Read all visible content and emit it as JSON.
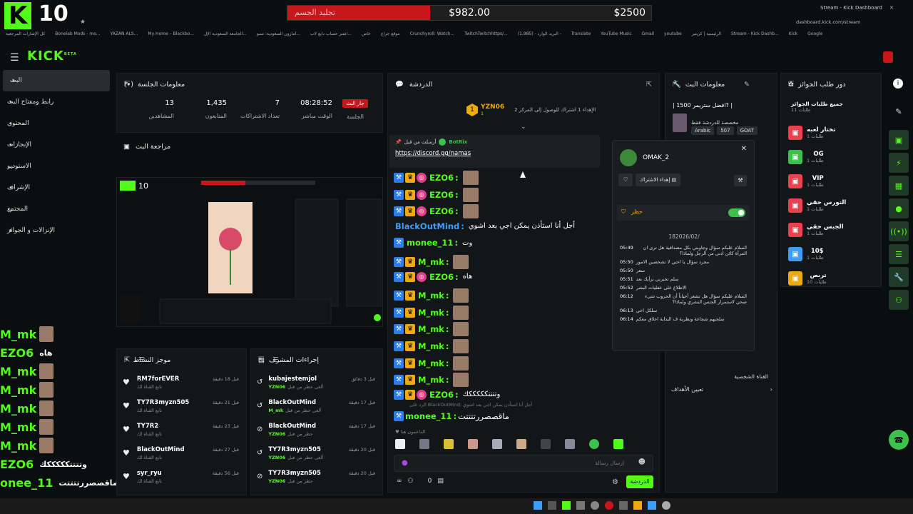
{
  "overlay": {
    "logo_letter": "K",
    "logo_number": "10",
    "goal": {
      "title": "تجليد الجسم",
      "current": "$982.00",
      "target": "$2500",
      "progress": 0.393,
      "color": "#c8161d"
    }
  },
  "browser": {
    "active_tab": "Stream - Kick Dashboard",
    "url": "dashboard.kick.com/stream",
    "bookmarks": [
      "كل الإشارات المرجعية",
      "Bonelab Mods - mo...",
      "YAZAN ALS...",
      "My Home – Blackbo...",
      "الجامعة السعودية الإل...",
      "أمازون السعودية: تسو...",
      "اشتر حساب دايغ لاب...",
      "خاص",
      "موقع جراج",
      "Crunchyroll: Watch...",
      "TwitchTwitchhttps/...",
      "(1,985) - البريد الوارد -",
      "Translate",
      "YouTube Music",
      "Gmail",
      "youtube",
      "الرئيسية | كريتير",
      "Stream - Kick Dashb...",
      "Kick",
      "Google"
    ]
  },
  "app": {
    "brand": "KICK",
    "brand_sup": "BETA"
  },
  "sidebar": {
    "items": [
      {
        "label": "البث",
        "icon": "broadcast-icon"
      },
      {
        "label": "رابط ومفتاح البث",
        "icon": "link-icon"
      },
      {
        "label": "المحتوى",
        "icon": "content-icon"
      },
      {
        "label": "الإنجازات",
        "icon": "trophy-icon"
      },
      {
        "label": "الاستوديو",
        "icon": "chevron-down-icon"
      },
      {
        "label": "الإشراف",
        "icon": "hammer-icon"
      },
      {
        "label": "المجتمع",
        "icon": "chevron-down-icon"
      },
      {
        "label": "الإنزالات و الجوائز",
        "icon": "gift-icon"
      }
    ]
  },
  "session": {
    "title": "معلومات الجلسة",
    "live_badge": "جار البث",
    "live_label": "الجلسة",
    "stats": [
      {
        "value": "08:28:52",
        "label": "الوقت مباشر"
      },
      {
        "value": "7",
        "label": "تعداد الاشتراكات"
      },
      {
        "value": "1,435",
        "label": "المتابعون"
      },
      {
        "value": "13",
        "label": "المشاهدين"
      }
    ]
  },
  "preview": {
    "title": "مراجعة البث"
  },
  "overlay_chat": [
    {
      "user": "M_mk",
      "text": "",
      "color": "#53fc18"
    },
    {
      "user": "EZO6",
      "text": "هاه",
      "color": "#53fc18"
    },
    {
      "user": "M_mk",
      "text": "",
      "color": "#53fc18"
    },
    {
      "user": "M_mk",
      "text": "",
      "color": "#53fc18"
    },
    {
      "user": "M_mk",
      "text": "",
      "color": "#53fc18"
    },
    {
      "user": "M_mk",
      "text": "",
      "color": "#53fc18"
    },
    {
      "user": "M_mk",
      "text": "",
      "color": "#53fc18"
    },
    {
      "user": "EZO6",
      "text": "وتتتتكككككك",
      "color": "#53fc18"
    },
    {
      "user": "onee_11",
      "text": "ماقصصررتتتتت",
      "color": "#53fc18"
    }
  ],
  "activity": {
    "title": "موجز النشاط",
    "rows": [
      {
        "name": "RM7forEVER",
        "sub": "تابع القناة لك",
        "time": "قبل 18 دقيقة"
      },
      {
        "name": "TY7R3myzn505",
        "sub": "تابع القناة لك",
        "time": "قبل 21 دقيقة"
      },
      {
        "name": "TY7R2",
        "sub": "تابع القناة لك",
        "time": "قبل 23 دقيقة"
      },
      {
        "name": "BlackOutMind",
        "sub": "تابع القناة لك",
        "time": "قبل 27 دقيقة"
      },
      {
        "name": "syr_ryu",
        "sub": "تابع القناة لك",
        "time": "قبل 56 دقيقة"
      }
    ]
  },
  "modactions": {
    "title": "إجراءات المشرف",
    "rows": [
      {
        "name": "kubajestemjol",
        "sub": "ألغى حظر من قبل",
        "by": "YZN06",
        "time": "قبل 3 دقائق"
      },
      {
        "name": "BlackOutMind",
        "sub": "ألغى حظر من قبل",
        "by": "M_mk",
        "time": "قبل 17 دقيقة"
      },
      {
        "name": "BlackOutMind",
        "sub": "حظر من قبل",
        "by": "YZN06",
        "time": "قبل 17 دقيقة"
      },
      {
        "name": "TY7R3myzn505",
        "sub": "ألغى حظر من قبل",
        "by": "YZN06",
        "time": "قبل 20 دقيقة"
      },
      {
        "name": "TY7R3myzn505",
        "sub": "حظر من قبل",
        "by": "YZN06",
        "time": "قبل 20 دقيقة"
      }
    ]
  },
  "chat": {
    "title": "الدردشة",
    "pinned_user": "YZN06",
    "pinned_sub": "1",
    "pinned_text": "الإهداء 1 اشتراك للوصول إلى المركز 2",
    "pinned_msg_header": "أرسلت من قبل",
    "pinned_msg_author": "BotRix",
    "pinned_link": "https://discord.gg/namas",
    "messages": [
      {
        "user": "EZO6",
        "text": "",
        "color": "#53fc18",
        "badges": [
          "mod",
          "crown",
          "pink"
        ],
        "emote": true
      },
      {
        "user": "EZO6",
        "text": "",
        "color": "#53fc18",
        "badges": [
          "mod",
          "crown",
          "pink"
        ],
        "emote": true
      },
      {
        "user": "EZO6",
        "text": "",
        "color": "#53fc18",
        "badges": [
          "mod",
          "crown",
          "pink"
        ],
        "emote": true
      },
      {
        "user": "BlackOutMind",
        "text": "أجل أنا استأذن يمكن اجي بعد اشوي",
        "color": "#3b9eff",
        "badges": [],
        "emote": false
      },
      {
        "user": "monee_11",
        "text": "وت",
        "color": "#53fc18",
        "badges": [
          "mod"
        ],
        "emote": false
      },
      {
        "user": "M_mk",
        "text": "",
        "color": "#53fc18",
        "badges": [
          "mod",
          "crown"
        ],
        "emote": true
      },
      {
        "user": "EZO6",
        "text": "هاه",
        "color": "#53fc18",
        "badges": [
          "mod",
          "crown",
          "pink"
        ],
        "emote": false
      },
      {
        "user": "M_mk",
        "text": "",
        "color": "#53fc18",
        "badges": [
          "mod",
          "crown"
        ],
        "emote": true
      },
      {
        "user": "M_mk",
        "text": "",
        "color": "#53fc18",
        "badges": [
          "mod",
          "crown"
        ],
        "emote": true
      },
      {
        "user": "M_mk",
        "text": "",
        "color": "#53fc18",
        "badges": [
          "mod",
          "crown"
        ],
        "emote": true
      },
      {
        "user": "M_mk",
        "text": "",
        "color": "#53fc18",
        "badges": [
          "mod",
          "crown"
        ],
        "emote": true
      },
      {
        "user": "M_mk",
        "text": "",
        "color": "#53fc18",
        "badges": [
          "mod",
          "crown"
        ],
        "emote": true
      },
      {
        "user": "M_mk",
        "text": "",
        "color": "#53fc18",
        "badges": [
          "mod",
          "crown"
        ],
        "emote": true
      },
      {
        "user": "EZO6",
        "text": "وتتتتكككككك",
        "color": "#53fc18",
        "badges": [
          "mod",
          "crown",
          "pink"
        ],
        "emote": false
      }
    ],
    "reply_hint": "أجل أنا استأذن يمكن اجي بعد اشوي :BlackOutMind الرد على",
    "last": {
      "user": "monee_11",
      "text": "ماقصصررتتتتت"
    },
    "top_supporters": "الداعمون هنا",
    "input_placeholder": "إرسال رسالة",
    "send_label": "الدردشة",
    "count_value": "0"
  },
  "user_popup": {
    "username": "OMAK_2",
    "gift_label": "إهداء الاشتراك",
    "ban_label": "حظر",
    "date": "182026/02/",
    "messages": [
      {
        "time": "05:49",
        "text": "السلام عليكم سؤال وجاوبني بكل مصداقية هل ترى ان المرأة كائن ادنى من الرجل ولماذا؟"
      },
      {
        "time": "05:50",
        "text": "مجرد سؤال يا اختي لا تشخصين الامور"
      },
      {
        "time": "05:50",
        "text": "سعر"
      },
      {
        "time": "05:51",
        "text": "سلم تخبرني برأيك بعد"
      },
      {
        "time": "05:52",
        "text": "الاطلاع على عقليات البشر"
      },
      {
        "time": "06:12",
        "text": "السلام عليكم سؤال هل تشعر أحياناً أن الحروب شيء صحي لاستمرار الجنس البشري ولماذا؟"
      },
      {
        "time": "06:13",
        "text": "سلكل اخي"
      },
      {
        "time": "06:14",
        "text": "سلحبهم شجاعة ونظرية ف البداية اخلاق معكم"
      }
    ]
  },
  "stream_info": {
    "title": "معلومات البث",
    "stream_title": "| افضل ستريمر 1500? |",
    "category": "مخصصة للدردشة فقط",
    "tags": [
      "GOAT",
      "507",
      "Arabic"
    ],
    "channel_label": "القناة الشخصية",
    "goals_label": "تعيين الأهداف"
  },
  "rewards": {
    "title": "دور طلب الجوائز",
    "all_label": "جميع طلبات الجوائز",
    "all_count": "طلبات 11",
    "items": [
      {
        "title": "تختار لعبه",
        "sub": "طلبات 1",
        "color": "#e9414d"
      },
      {
        "title": "OG",
        "sub": "طلبات 1",
        "color": "#3ac24c"
      },
      {
        "title": "VIP",
        "sub": "طلبات 1",
        "color": "#e9414d"
      },
      {
        "title": "التورس حقي",
        "sub": "طلبات 1",
        "color": "#e9414d"
      },
      {
        "title": "الجبس حقي",
        "sub": "طلبات 1",
        "color": "#e9414d"
      },
      {
        "title": "10$",
        "sub": "طلبات 1",
        "color": "#3b9eff"
      },
      {
        "title": "تربص",
        "sub": "طلبات 10",
        "color": "#f0a90e"
      }
    ]
  }
}
